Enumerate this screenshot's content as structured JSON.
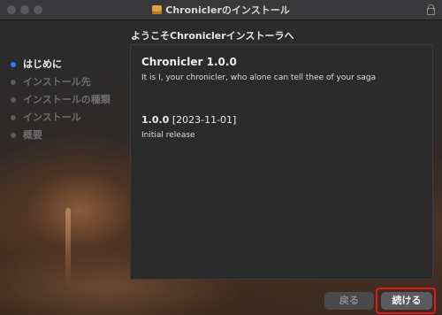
{
  "window": {
    "title": "Chroniclerのインストール"
  },
  "heading": "ようこそChroniclerインストーラへ",
  "steps": [
    {
      "label": "はじめに",
      "active": true
    },
    {
      "label": "インストール先",
      "active": false
    },
    {
      "label": "インストールの種類",
      "active": false
    },
    {
      "label": "インストール",
      "active": false
    },
    {
      "label": "概要",
      "active": false
    }
  ],
  "panel": {
    "title": "Chronicler 1.0.0",
    "description": "It is I, your chronicler, who alone can tell thee of your saga",
    "version": "1.0.0",
    "date": "[2023-11-01]",
    "note": "Initial release"
  },
  "buttons": {
    "back": "戻る",
    "continue": "続ける"
  },
  "colors": {
    "active_step": "#2f7df6",
    "highlight": "#e01a1a"
  }
}
